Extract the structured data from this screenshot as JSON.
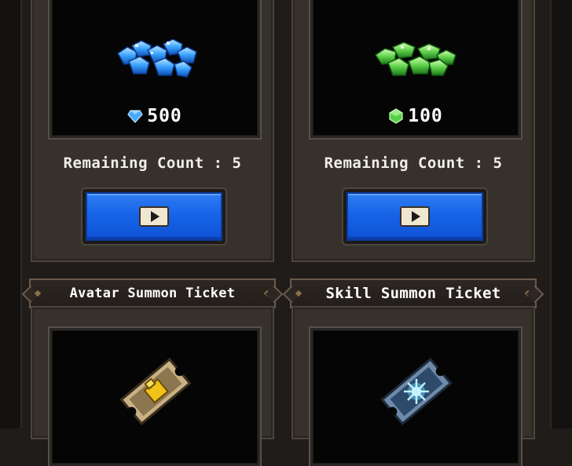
{
  "offers": [
    {
      "currency_icon": "blue-diamond-icon",
      "amount": "500",
      "remaining_label": "Remaining Count : 5",
      "button_icon": "play-video-icon",
      "accent": "#4aa8ff"
    },
    {
      "currency_icon": "green-gem-icon",
      "amount": "100",
      "remaining_label": "Remaining Count : 5",
      "button_icon": "play-video-icon",
      "accent": "#57d14a"
    }
  ],
  "tickets": [
    {
      "title": "Avatar Summon Ticket",
      "icon": "avatar-ticket-icon",
      "color": "#f0c21a"
    },
    {
      "title": "Skill Summon Ticket",
      "icon": "skill-ticket-icon",
      "color": "#5fd2ff"
    }
  ],
  "colors": {
    "background": "#1f1c1a",
    "card": "#37312c",
    "button": "#1764e8"
  }
}
